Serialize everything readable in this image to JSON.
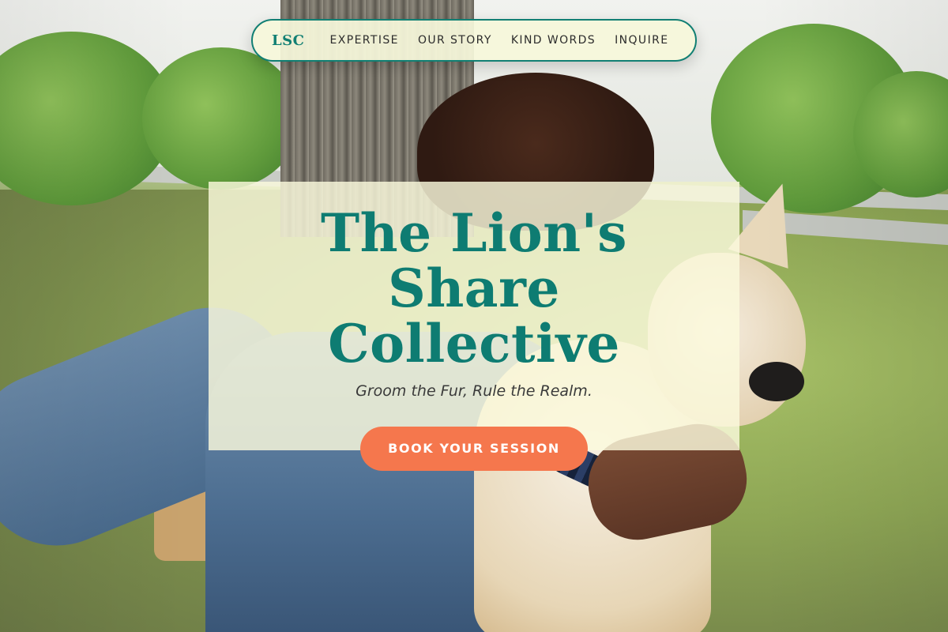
{
  "nav": {
    "logo": "LSC",
    "links": [
      "EXPERTISE",
      "OUR STORY",
      "KIND WORDS",
      "INQUIRE"
    ]
  },
  "hero": {
    "title": "The Lion's Share Collective",
    "tagline": "Groom the Fur, Rule the Realm.",
    "cta_label": "BOOK YOUR SESSION"
  },
  "colors": {
    "accent_teal": "#0e7c72",
    "cta_orange": "#f5774d",
    "card_cream": "#fbfadd"
  }
}
